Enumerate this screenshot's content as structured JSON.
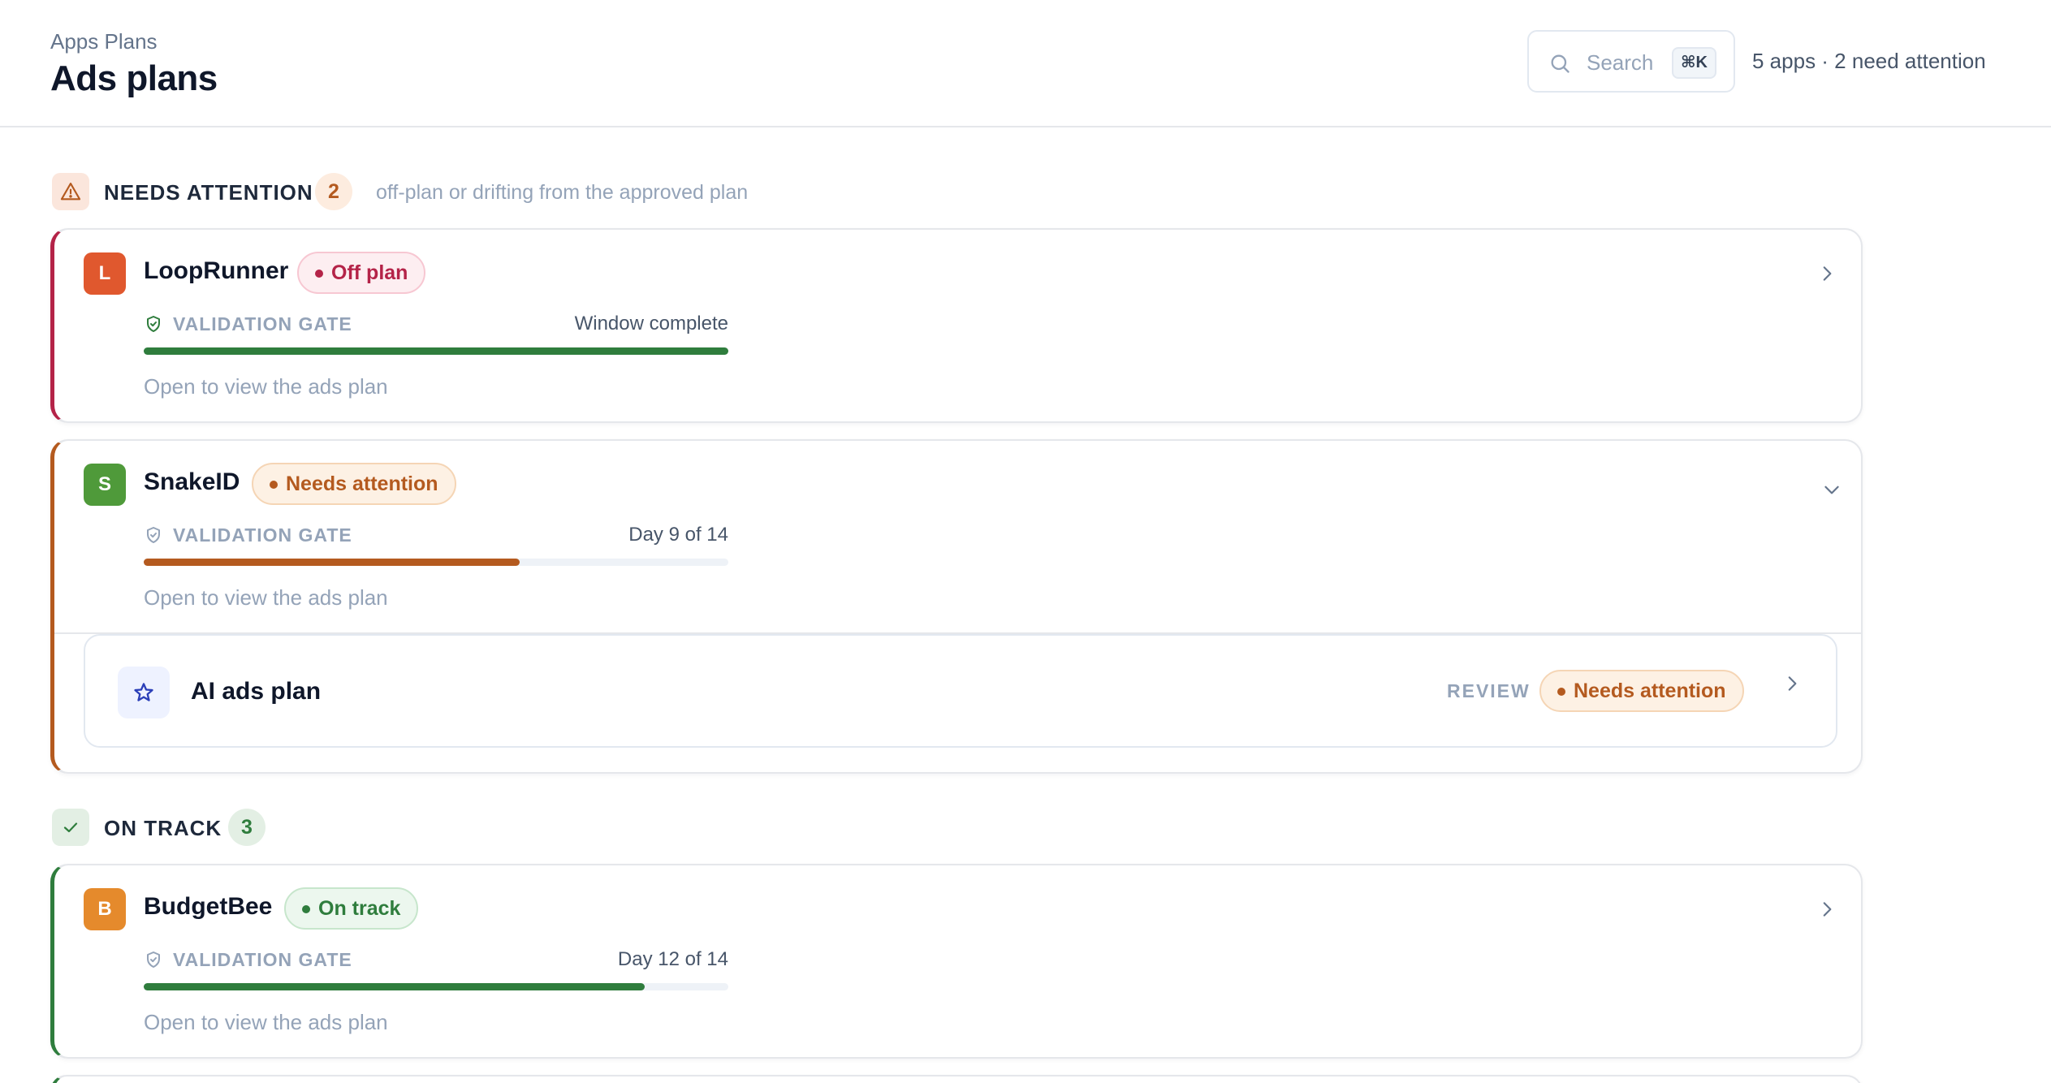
{
  "header": {
    "breadcrumb": "Apps Plans",
    "title": "Ads plans",
    "search_placeholder": "Search",
    "search_shortcut": "⌘K",
    "summary": "5 apps · 2 need attention"
  },
  "needs_attention": {
    "label": "NEEDS ATTENTION",
    "count": "2",
    "description": "off-plan or drifting from the approved plan",
    "apps": [
      {
        "initial": "L",
        "name": "LoopRunner",
        "status": "Off plan",
        "gate_label": "VALIDATION GATE",
        "gate_value": "Window complete",
        "progress": 1.0,
        "open_text": "Open to view the ads plan",
        "accent": "#b42348"
      },
      {
        "initial": "S",
        "name": "SnakeID",
        "status": "Needs attention",
        "gate_label": "VALIDATION GATE",
        "gate_value": "Day 9 of 14",
        "progress": 0.643,
        "open_text": "Open to view the ads plan",
        "accent": "#b45a1f",
        "sub_item": {
          "title": "AI ads plan",
          "review_label": "REVIEW",
          "status": "Needs attention"
        }
      }
    ]
  },
  "on_track": {
    "label": "ON TRACK",
    "count": "3",
    "apps": [
      {
        "initial": "B",
        "name": "BudgetBee",
        "status": "On track",
        "gate_label": "VALIDATION GATE",
        "gate_value": "Day 12 of 14",
        "progress": 0.857,
        "open_text": "Open to view the ads plan",
        "accent": "#2f7d3d"
      }
    ]
  },
  "colors": {
    "off_plan": "#b42348",
    "needs_attention": "#b45a1f",
    "on_track": "#2f7d3d"
  }
}
